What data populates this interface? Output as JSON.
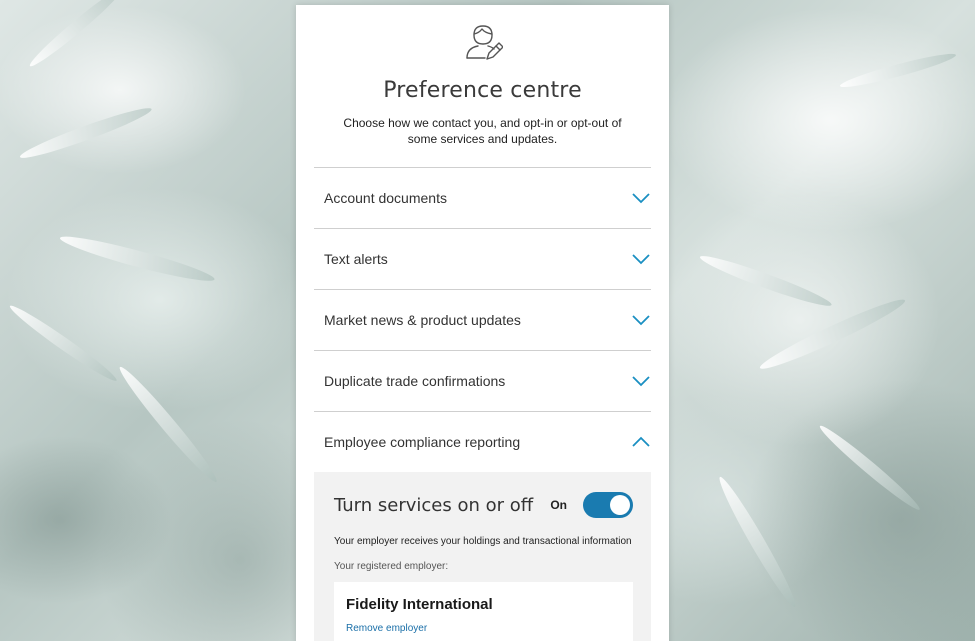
{
  "header": {
    "icon": "user-edit-icon",
    "title": "Preference centre",
    "subtitle": "Choose how we contact you, and opt-in or opt-out of some services and updates."
  },
  "sections": [
    {
      "label": "Account documents",
      "expanded": false
    },
    {
      "label": "Text alerts",
      "expanded": false
    },
    {
      "label": "Market news & product updates",
      "expanded": false
    },
    {
      "label": "Duplicate trade confirmations",
      "expanded": false
    },
    {
      "label": "Employee compliance reporting",
      "expanded": true
    }
  ],
  "compliance_panel": {
    "title": "Turn services on or off",
    "toggle_state": "On",
    "toggle_on": true,
    "description": "Your employer receives your holdings and transactional information",
    "employer_label": "Your registered employer:",
    "employer_name": "Fidelity International",
    "remove_label": "Remove employer"
  },
  "colors": {
    "accent": "#1a7bb0",
    "chevron": "#1a8fc2"
  }
}
